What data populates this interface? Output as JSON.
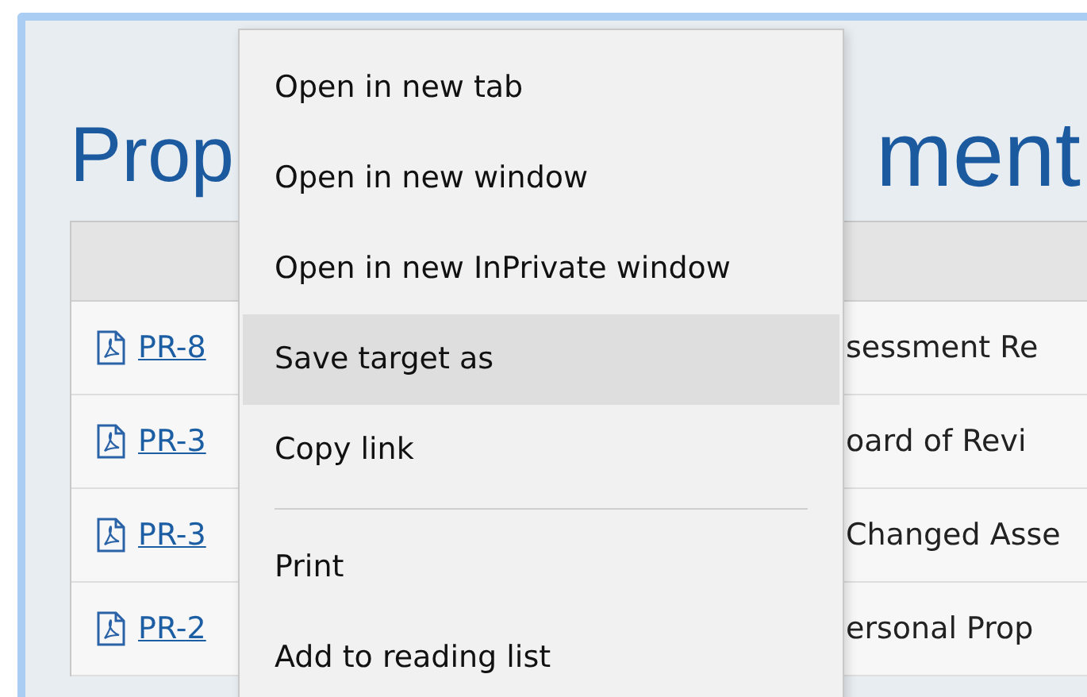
{
  "page": {
    "title_start": "Prop",
    "title_end": "ment"
  },
  "table": {
    "rows": [
      {
        "link": "PR-8",
        "column_2": "sessment Re"
      },
      {
        "link": "PR-3",
        "column_2": "oard of Revi"
      },
      {
        "link": "PR-3",
        "column_2": "Changed Asse"
      },
      {
        "link": "PR-2",
        "column_2": "ersonal Prop"
      }
    ]
  },
  "context_menu": {
    "items": [
      {
        "kind": "item",
        "label": "Open in new tab",
        "selected": false
      },
      {
        "kind": "item",
        "label": "Open in new window",
        "selected": false
      },
      {
        "kind": "item",
        "label": "Open in new InPrivate window",
        "selected": false
      },
      {
        "kind": "item",
        "label": "Save target as",
        "selected": true
      },
      {
        "kind": "item",
        "label": "Copy link",
        "selected": false
      },
      {
        "kind": "separator"
      },
      {
        "kind": "item",
        "label": "Print",
        "selected": false
      },
      {
        "kind": "item",
        "label": "Add to reading list",
        "selected": false
      }
    ]
  }
}
